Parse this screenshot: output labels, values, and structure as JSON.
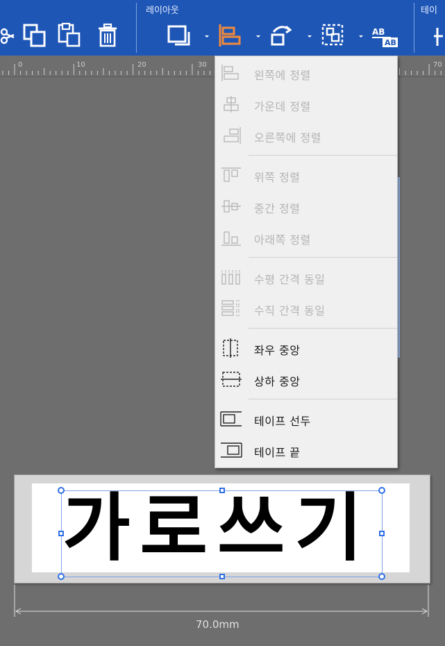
{
  "toolbar": {
    "layout_group_label": "레이아웃",
    "next_group_label": "테이",
    "buttons": [
      "cut-icon",
      "copy-icon",
      "paste-icon",
      "delete-icon",
      "frame-icon",
      "align-icon",
      "rotate-icon",
      "group-icon",
      "text-style-icon"
    ],
    "accent_color": "#f08a3c"
  },
  "ruler": {
    "labels": [
      "0",
      "10",
      "20",
      "30",
      "70"
    ]
  },
  "menu": {
    "items": [
      {
        "label": "왼쪽에 정렬",
        "icon": "align-left-icon",
        "enabled": false
      },
      {
        "label": "가운데 정렬",
        "icon": "align-center-icon",
        "enabled": false
      },
      {
        "label": "오른쪽에 정렬",
        "icon": "align-right-icon",
        "enabled": false
      },
      {
        "label": "위쪽 정렬",
        "icon": "align-top-icon",
        "enabled": false
      },
      {
        "label": "중간 정렬",
        "icon": "align-middle-icon",
        "enabled": false
      },
      {
        "label": "아래쪽 정렬",
        "icon": "align-bottom-icon",
        "enabled": false
      },
      {
        "label": "수평 간격 동일",
        "icon": "distribute-horizontal-icon",
        "enabled": false
      },
      {
        "label": "수직 간격 동일",
        "icon": "distribute-vertical-icon",
        "enabled": false
      },
      {
        "label": "좌우 중앙",
        "icon": "center-horizontal-icon",
        "enabled": true
      },
      {
        "label": "상하 중앙",
        "icon": "center-vertical-icon",
        "enabled": true
      },
      {
        "label": "테이프 선두",
        "icon": "tape-start-icon",
        "enabled": true
      },
      {
        "label": "테이프 끝",
        "icon": "tape-end-icon",
        "enabled": true
      }
    ]
  },
  "label": {
    "text": "가로쓰기",
    "width_label": "70.0mm"
  }
}
